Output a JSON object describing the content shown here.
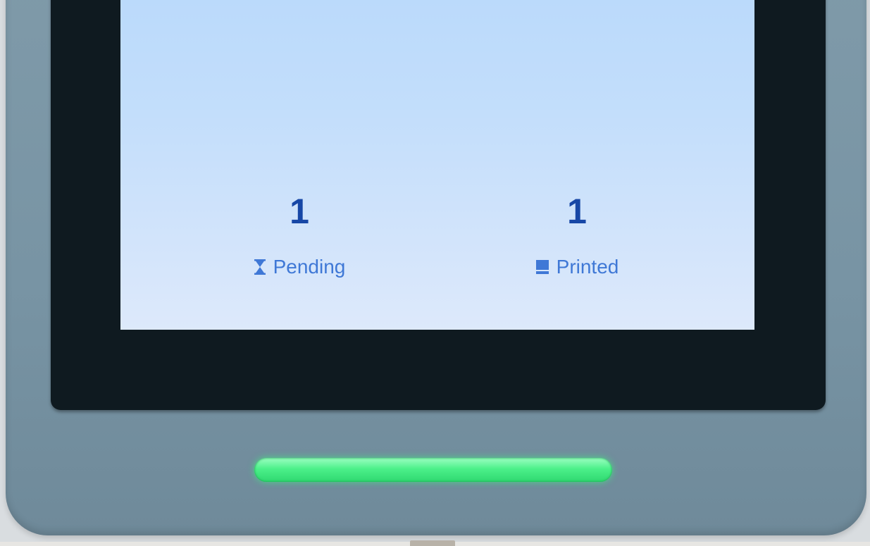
{
  "screen": {
    "stats": [
      {
        "count": "1",
        "label": "Pending",
        "icon": "hourglass-icon"
      },
      {
        "count": "1",
        "label": "Printed",
        "icon": "printer-icon"
      }
    ]
  },
  "colors": {
    "screen_bg": "#c3defb",
    "text_count": "#1747a6",
    "text_label": "#3f78d6",
    "device_body": "#7f9aa9",
    "bezel": "#0f1a20",
    "status_led": "#4cf08a"
  },
  "status_led": {
    "state": "on",
    "color": "green"
  }
}
